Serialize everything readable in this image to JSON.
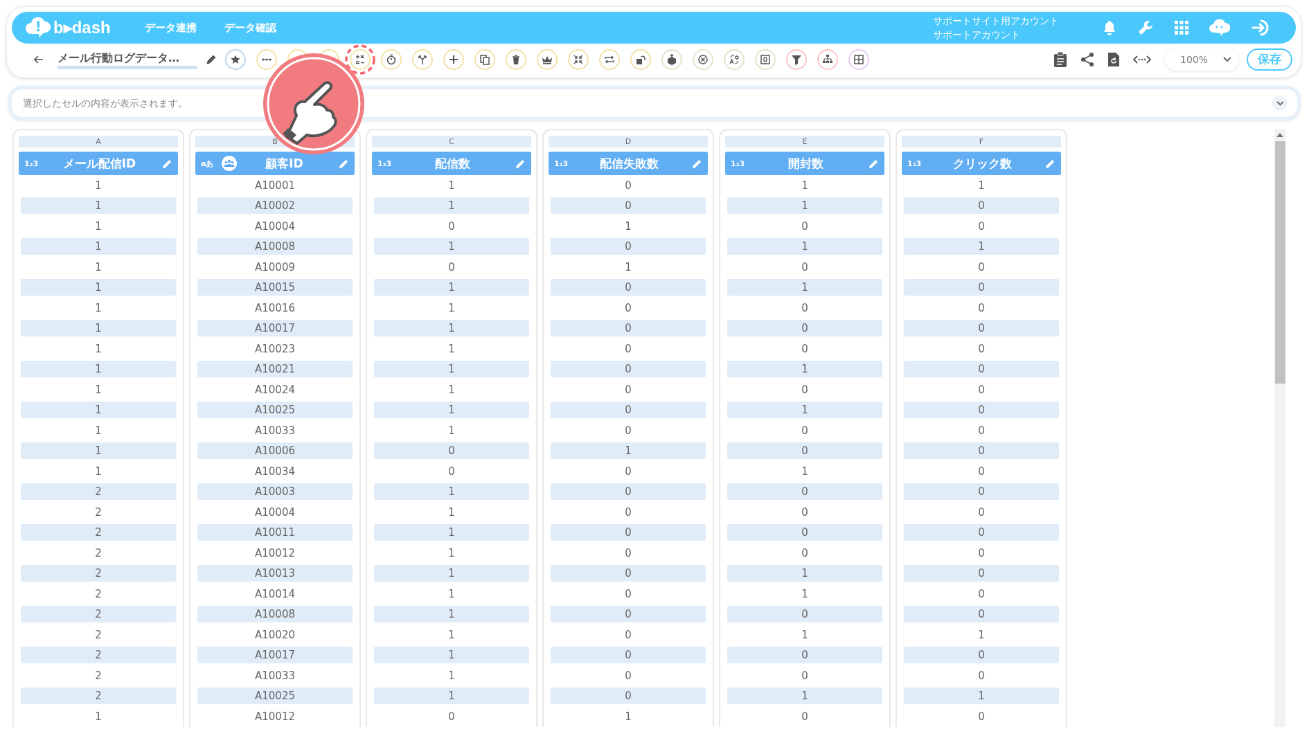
{
  "header": {
    "logo": "b▸dash",
    "nav": [
      "データ連携",
      "データ確認"
    ],
    "account": [
      "サポートサイト用アカウント",
      "サポートアカウント"
    ]
  },
  "toolbar": {
    "title": "メール行動ログデータ…",
    "zoom": "100%",
    "save": "保存"
  },
  "formula_bar": {
    "placeholder": "選択したセルの内容が表示されます。"
  },
  "columns": [
    {
      "letter": "A",
      "title": "メール配信ID",
      "kind": "number",
      "type_label": "1₂3"
    },
    {
      "letter": "B",
      "title": "顧客ID",
      "kind": "text",
      "type_label": "aあ"
    },
    {
      "letter": "C",
      "title": "配信数",
      "kind": "number",
      "type_label": "1₂3"
    },
    {
      "letter": "D",
      "title": "配信失敗数",
      "kind": "number",
      "type_label": "1₂3"
    },
    {
      "letter": "E",
      "title": "開封数",
      "kind": "number",
      "type_label": "1₂3"
    },
    {
      "letter": "F",
      "title": "クリック数",
      "kind": "number",
      "type_label": "1₂3"
    }
  ],
  "rows": [
    [
      "1",
      "A10001",
      "1",
      "0",
      "1",
      "1"
    ],
    [
      "1",
      "A10002",
      "1",
      "0",
      "1",
      "0"
    ],
    [
      "1",
      "A10004",
      "0",
      "1",
      "0",
      "0"
    ],
    [
      "1",
      "A10008",
      "1",
      "0",
      "1",
      "1"
    ],
    [
      "1",
      "A10009",
      "0",
      "1",
      "0",
      "0"
    ],
    [
      "1",
      "A10015",
      "1",
      "0",
      "1",
      "0"
    ],
    [
      "1",
      "A10016",
      "1",
      "0",
      "0",
      "0"
    ],
    [
      "1",
      "A10017",
      "1",
      "0",
      "0",
      "0"
    ],
    [
      "1",
      "A10023",
      "1",
      "0",
      "0",
      "0"
    ],
    [
      "1",
      "A10021",
      "1",
      "0",
      "1",
      "0"
    ],
    [
      "1",
      "A10024",
      "1",
      "0",
      "0",
      "0"
    ],
    [
      "1",
      "A10025",
      "1",
      "0",
      "1",
      "0"
    ],
    [
      "1",
      "A10033",
      "1",
      "0",
      "0",
      "0"
    ],
    [
      "1",
      "A10006",
      "0",
      "1",
      "0",
      "0"
    ],
    [
      "1",
      "A10034",
      "0",
      "0",
      "1",
      "0"
    ],
    [
      "2",
      "A10003",
      "1",
      "0",
      "0",
      "0"
    ],
    [
      "2",
      "A10004",
      "1",
      "0",
      "0",
      "0"
    ],
    [
      "2",
      "A10011",
      "1",
      "0",
      "0",
      "0"
    ],
    [
      "2",
      "A10012",
      "1",
      "0",
      "0",
      "0"
    ],
    [
      "2",
      "A10013",
      "1",
      "0",
      "1",
      "0"
    ],
    [
      "2",
      "A10014",
      "1",
      "0",
      "1",
      "0"
    ],
    [
      "2",
      "A10008",
      "1",
      "0",
      "0",
      "0"
    ],
    [
      "2",
      "A10020",
      "1",
      "0",
      "1",
      "1"
    ],
    [
      "2",
      "A10017",
      "1",
      "0",
      "0",
      "0"
    ],
    [
      "2",
      "A10033",
      "1",
      "0",
      "0",
      "0"
    ],
    [
      "2",
      "A10025",
      "1",
      "0",
      "1",
      "1"
    ],
    [
      "1",
      "A10012",
      "0",
      "1",
      "0",
      "0"
    ]
  ]
}
